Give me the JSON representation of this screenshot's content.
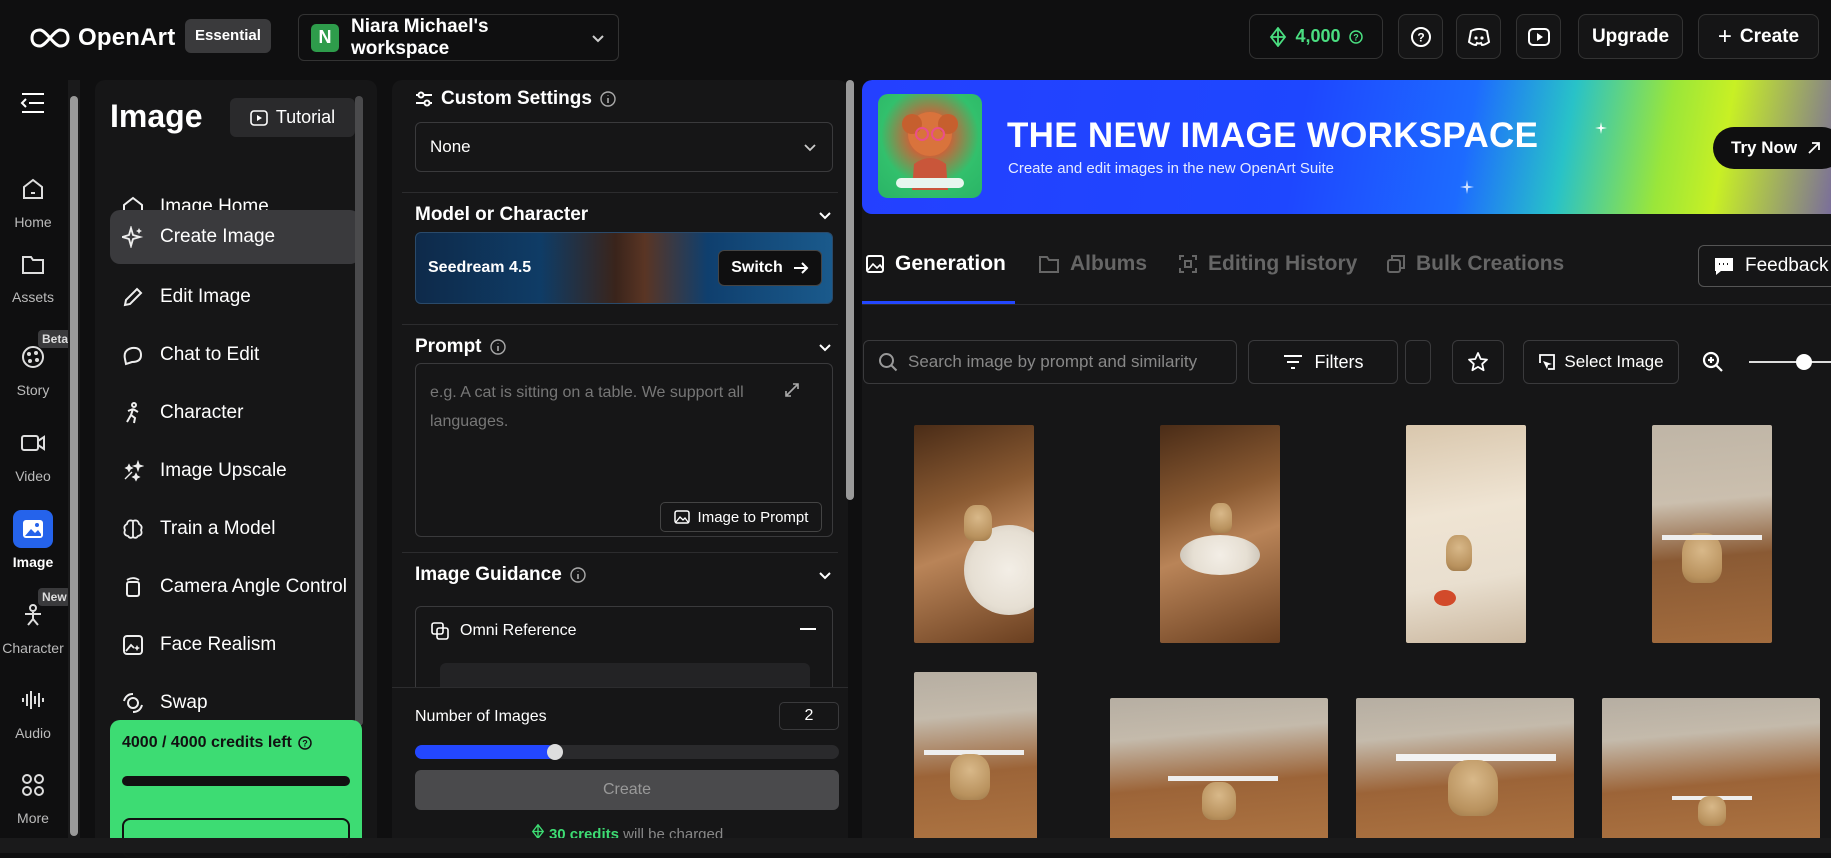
{
  "header": {
    "brand": "OpenArt",
    "plan_badge": "Essential",
    "workspace_initial": "N",
    "workspace_name": "Niara Michael's workspace",
    "credits": "4,000",
    "upgrade_label": "Upgrade",
    "create_label": "Create"
  },
  "rail": {
    "items": [
      {
        "label": "Home",
        "icon": "home-icon"
      },
      {
        "label": "Assets",
        "icon": "folder-icon"
      },
      {
        "label": "Story",
        "icon": "film-reel-icon",
        "tag": "Beta"
      },
      {
        "label": "Video",
        "icon": "video-camera-icon"
      },
      {
        "label": "Image",
        "icon": "image-icon"
      },
      {
        "label": "Character",
        "icon": "character-icon",
        "tag": "New"
      },
      {
        "label": "Audio",
        "icon": "audio-wave-icon"
      },
      {
        "label": "More",
        "icon": "grid-icon"
      }
    ]
  },
  "subnav": {
    "title": "Image",
    "tutorial_label": "Tutorial",
    "items": [
      {
        "label": "Image Home",
        "icon": "home-icon"
      },
      {
        "label": "Create Image",
        "icon": "sparkle-icon"
      },
      {
        "label": "Edit Image",
        "icon": "pencil-icon"
      },
      {
        "label": "Chat to Edit",
        "icon": "chat-icon"
      },
      {
        "label": "Character",
        "icon": "person-running-icon"
      },
      {
        "label": "Image Upscale",
        "icon": "upscale-icon"
      },
      {
        "label": "Train a Model",
        "icon": "brain-icon"
      },
      {
        "label": "Camera Angle Control",
        "icon": "camera-rotate-icon"
      },
      {
        "label": "Face Realism",
        "icon": "face-image-icon"
      },
      {
        "label": "Swap",
        "icon": "swap-face-icon"
      }
    ],
    "credits_text": "4000 / 4000 credits left",
    "credits_fraction": 1.0
  },
  "settings": {
    "custom_settings_title": "Custom Settings",
    "custom_settings_value": "None",
    "model_title": "Model or Character",
    "model_name": "Seedream 4.5",
    "switch_label": "Switch",
    "prompt_title": "Prompt",
    "prompt_placeholder": "e.g. A cat is sitting on a table. We support all languages.",
    "image_to_prompt_label": "Image to Prompt",
    "guidance_title": "Image Guidance",
    "omni_label": "Omni Reference",
    "num_images_label": "Number of Images",
    "num_images_value": "2",
    "num_images_fraction": 0.33,
    "create_label": "Create",
    "charge_credits": "30 credits",
    "charge_suffix": "will be charged"
  },
  "banner": {
    "title": "THE NEW IMAGE WORKSPACE",
    "subtitle": "Create and edit images in the new OpenArt Suite",
    "try_label": "Try Now"
  },
  "tabs": [
    {
      "label": "Generation",
      "icon": "image-stack-icon"
    },
    {
      "label": "Albums",
      "icon": "folder-icon"
    },
    {
      "label": "Editing History",
      "icon": "edit-frame-icon"
    },
    {
      "label": "Bulk Creations",
      "icon": "copy-icon"
    }
  ],
  "feedback_label": "Feedback",
  "toolbar": {
    "search_placeholder": "Search image by prompt and similarity",
    "filters_label": "Filters",
    "select_image_label": "Select Image"
  },
  "colors": {
    "accent_blue": "#2347ff",
    "credit_green": "#3ddc73",
    "background": "#0f0f10",
    "panel": "#161617"
  }
}
